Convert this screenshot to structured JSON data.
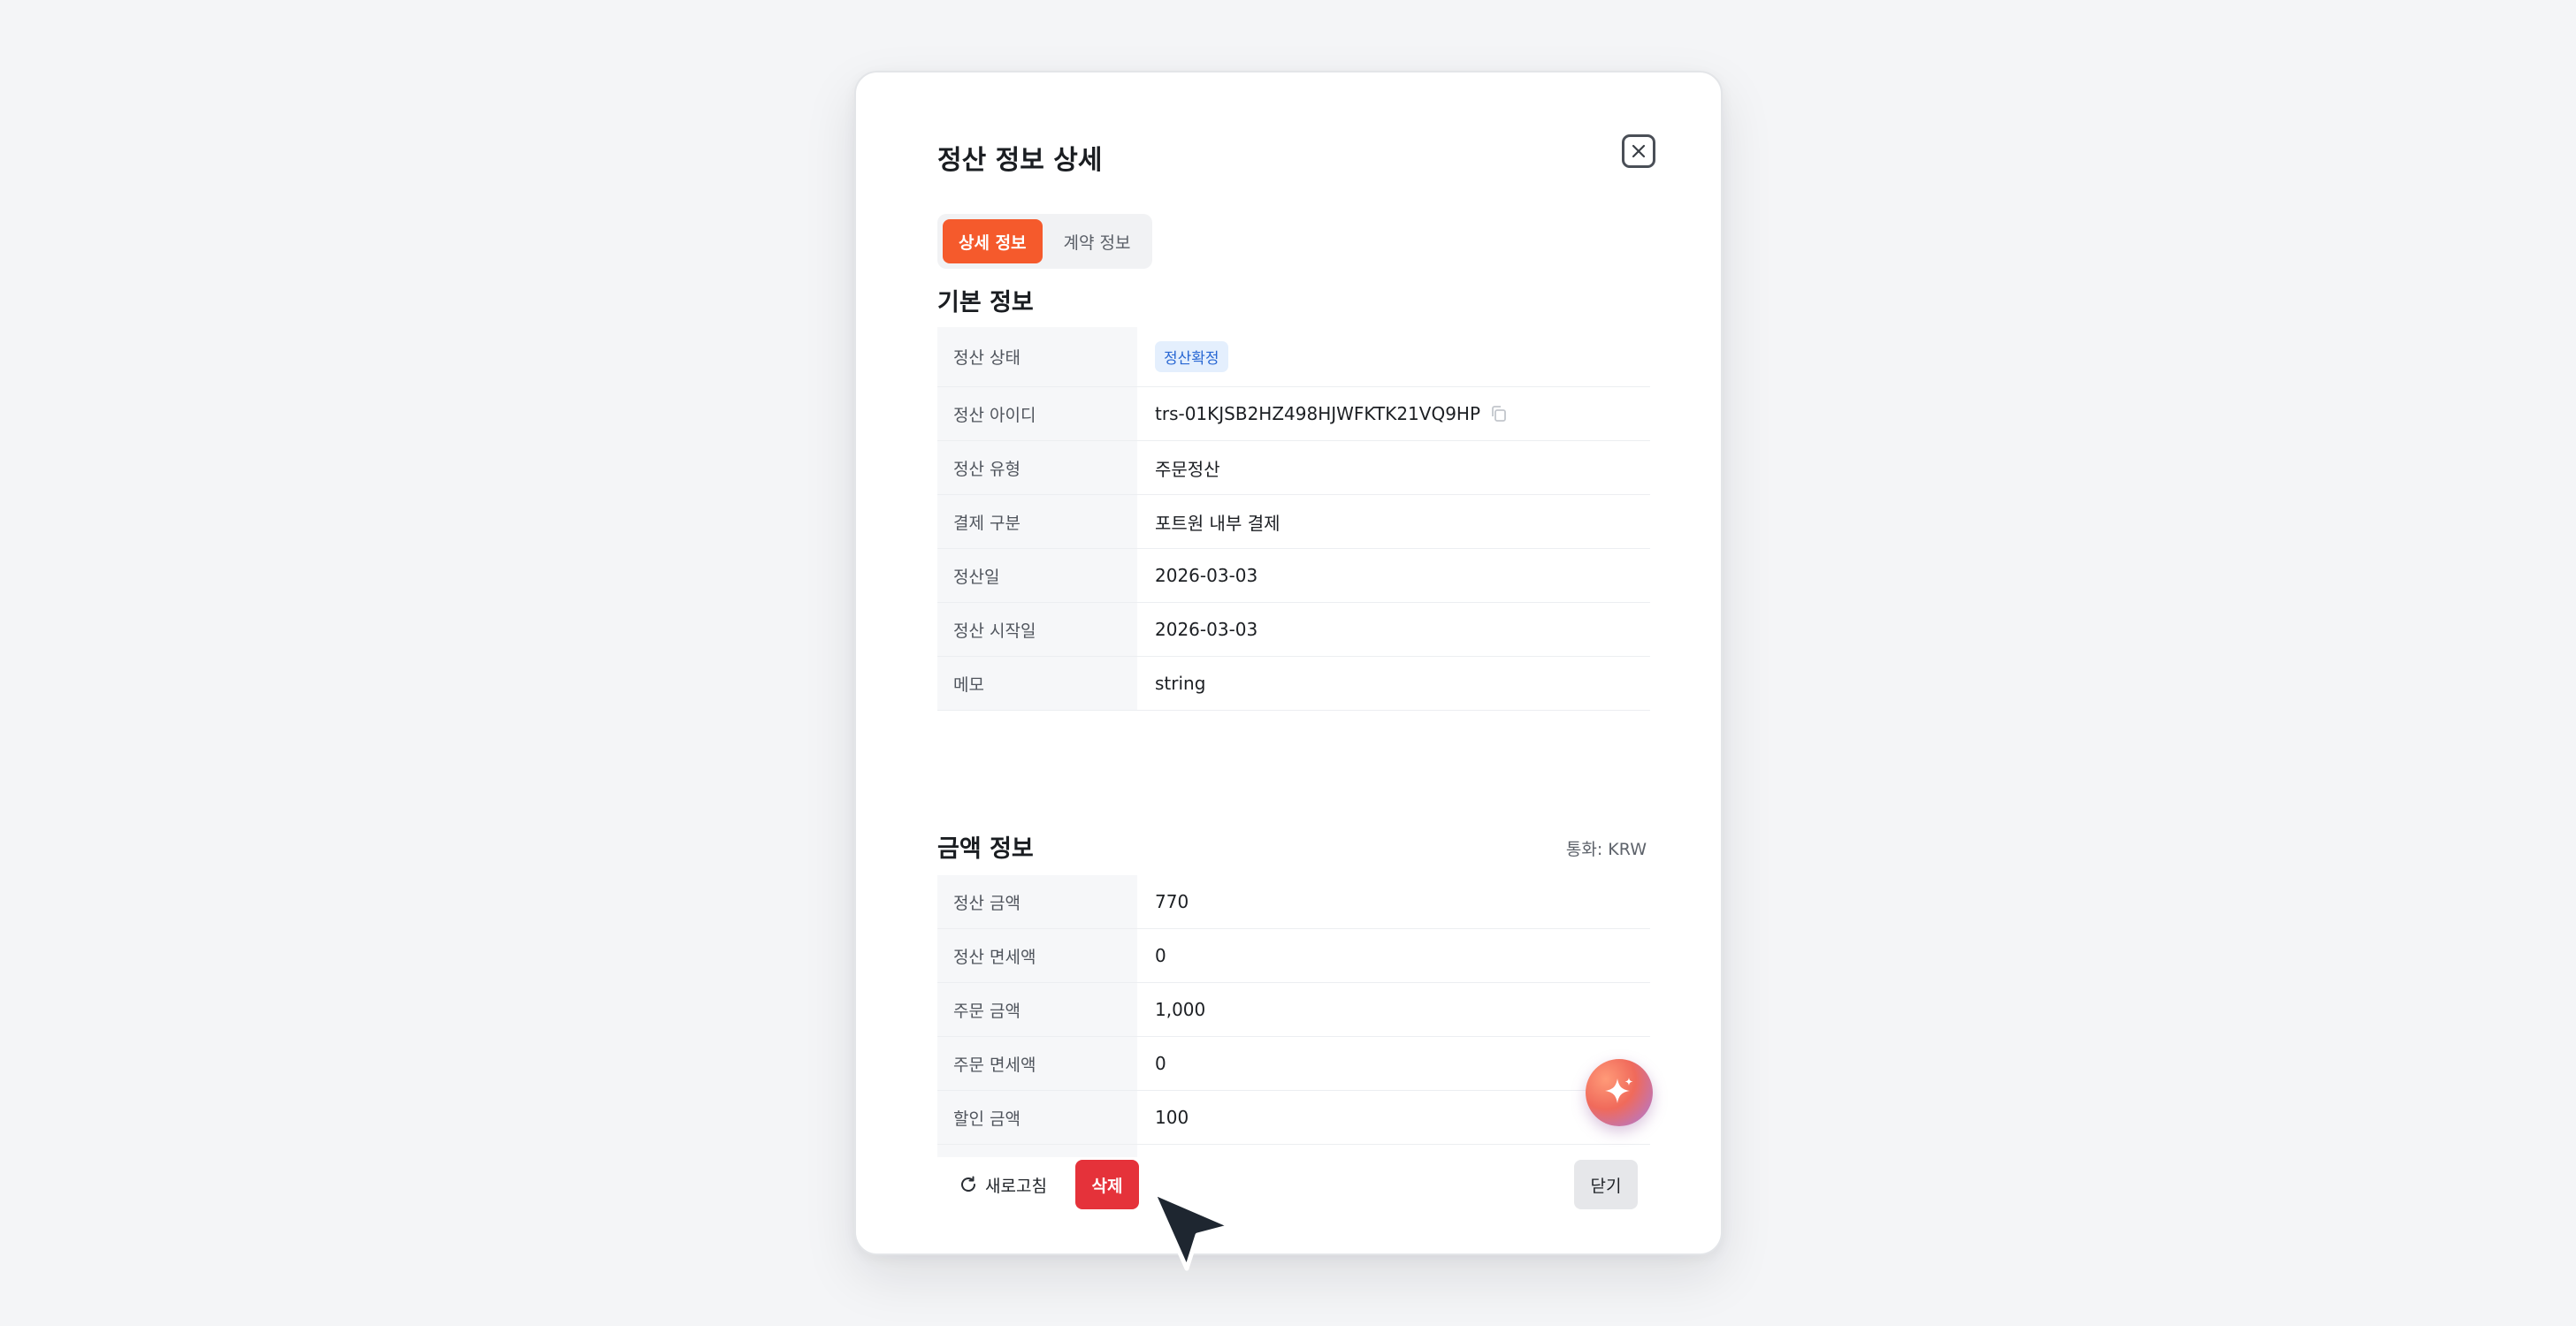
{
  "modal": {
    "title": "정산 정보 상세",
    "tabs": [
      {
        "label": "상세 정보",
        "active": true
      },
      {
        "label": "계약 정보",
        "active": false
      }
    ]
  },
  "basic_info": {
    "title": "기본 정보",
    "status_label": "정산 상태",
    "status_badge": "정산확정",
    "rows": [
      {
        "label": "정산 아이디",
        "value": "trs-01KJSB2HZ498HJWFKTK21VQ9HP"
      },
      {
        "label": "정산 유형",
        "value": "주문정산"
      },
      {
        "label": "결제 구분",
        "value": "포트원 내부 결제"
      },
      {
        "label": "정산일",
        "value": "2026-03-03"
      },
      {
        "label": "정산 시작일",
        "value": "2026-03-03"
      },
      {
        "label": "메모",
        "value": "string"
      }
    ]
  },
  "amount_info": {
    "title": "금액 정보",
    "currency": "통화: KRW",
    "rows": [
      {
        "label": "정산 금액",
        "value": "770"
      },
      {
        "label": "정산 면세액",
        "value": "0"
      },
      {
        "label": "주문 금액",
        "value": "1,000"
      },
      {
        "label": "주문 면세액",
        "value": "0"
      },
      {
        "label": "할인 금액",
        "value": "100"
      }
    ]
  },
  "footer": {
    "refresh_label": "새로고침",
    "delete_label": "삭제",
    "close_label": "닫기"
  },
  "colors": {
    "accent": "#f55a2c",
    "danger": "#e5323a",
    "badge_text": "#2867d3",
    "badge_bg": "#e4effd"
  },
  "icons": [
    "close-icon",
    "copy-icon",
    "refresh-icon",
    "sparkle-icon",
    "mouse-cursor-icon"
  ]
}
